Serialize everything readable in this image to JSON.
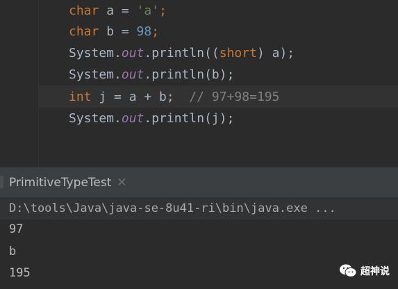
{
  "editor": {
    "lines": [
      {
        "kw": "char",
        "rest": " a = ",
        "str": "'a'",
        "end": ";"
      },
      {
        "kw": "char",
        "rest": " b = ",
        "num": "98",
        "end": ";"
      },
      {
        "prefix": "System.",
        "field": "out",
        "mid": ".println((",
        "kw": "short",
        "end": ") a);"
      },
      {
        "prefix": "System.",
        "field": "out",
        "end": ".println(b);"
      },
      {
        "kw": "int",
        "rest": " j = a + b;",
        "comment": "  // 97+98=195"
      },
      {
        "prefix": "System.",
        "field": "out",
        "end": ".println(j);"
      }
    ]
  },
  "run_window": {
    "tab_title": "PrimitiveTypeTest",
    "close_glyph": "✕",
    "command": "D:\\tools\\Java\\java-se-8u41-ri\\bin\\java.exe ...",
    "output": [
      "97",
      "b",
      "195"
    ]
  },
  "watermark": {
    "text": "超神说",
    "icon": "wechat-icon"
  },
  "colors": {
    "background": "#2b2b2b",
    "keyword": "#cc7832",
    "string": "#6a8759",
    "number": "#6897bb",
    "field": "#9876aa",
    "comment": "#808080",
    "text": "#a9b7c6",
    "tool_header": "#3c3f41"
  }
}
